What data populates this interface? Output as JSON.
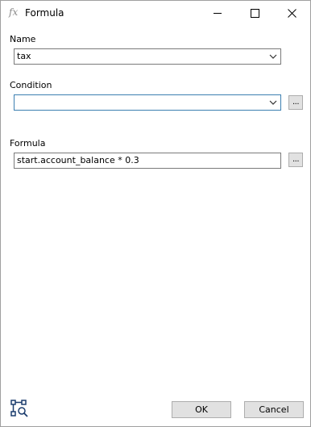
{
  "window": {
    "title": "Formula",
    "icon": "fx-icon",
    "icon_text": "fx",
    "controls": [
      "minimize-icon",
      "maximize-icon",
      "close-icon"
    ]
  },
  "form": {
    "name_label": "Name",
    "name_value": "tax",
    "condition_label": "Condition",
    "condition_value": "",
    "condition_browse": "...",
    "formula_label": "Formula",
    "formula_value": "start.account_balance * 0.3",
    "formula_browse": "..."
  },
  "footer": {
    "ok_label": "OK",
    "cancel_label": "Cancel",
    "left_icon": "search-tree-icon"
  },
  "colors": {
    "focus_border": "#3c7fb1",
    "field_border": "#7a7a7a",
    "button_bg": "#e1e1e1",
    "icon_blue": "#1c3d6e"
  }
}
